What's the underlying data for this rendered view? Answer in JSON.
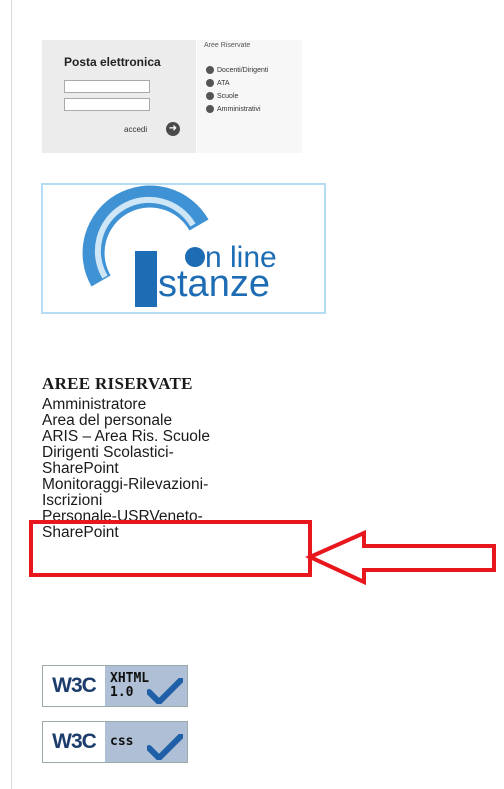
{
  "mail": {
    "title": "Posta elettronica",
    "submit_label": "accedi"
  },
  "area_personale": {
    "title": "Aree Riservate",
    "items": [
      "Docenti/Dirigenti",
      "ATA",
      "Scuole",
      "Amministrativi"
    ]
  },
  "banner": {
    "line1": "n line",
    "line2": "stanze"
  },
  "aree_riservate": {
    "title": "AREE RISERVATE",
    "links": [
      "Amministratore",
      "Area del personale",
      "ARIS – Area Ris. Scuole",
      "Dirigenti Scolastici-",
      "SharePoint",
      "Monitoraggi-Rilevazioni-",
      "Iscrizioni",
      "Personale-USRVeneto-",
      "SharePoint"
    ]
  },
  "badges": {
    "xhtml": {
      "logo": "W3C",
      "line1": "XHTML",
      "line2": "1.0"
    },
    "css": {
      "logo": "W3C",
      "line1": "css"
    }
  },
  "colors": {
    "highlight": "#e8161d",
    "brand_blue": "#1e6db4"
  }
}
